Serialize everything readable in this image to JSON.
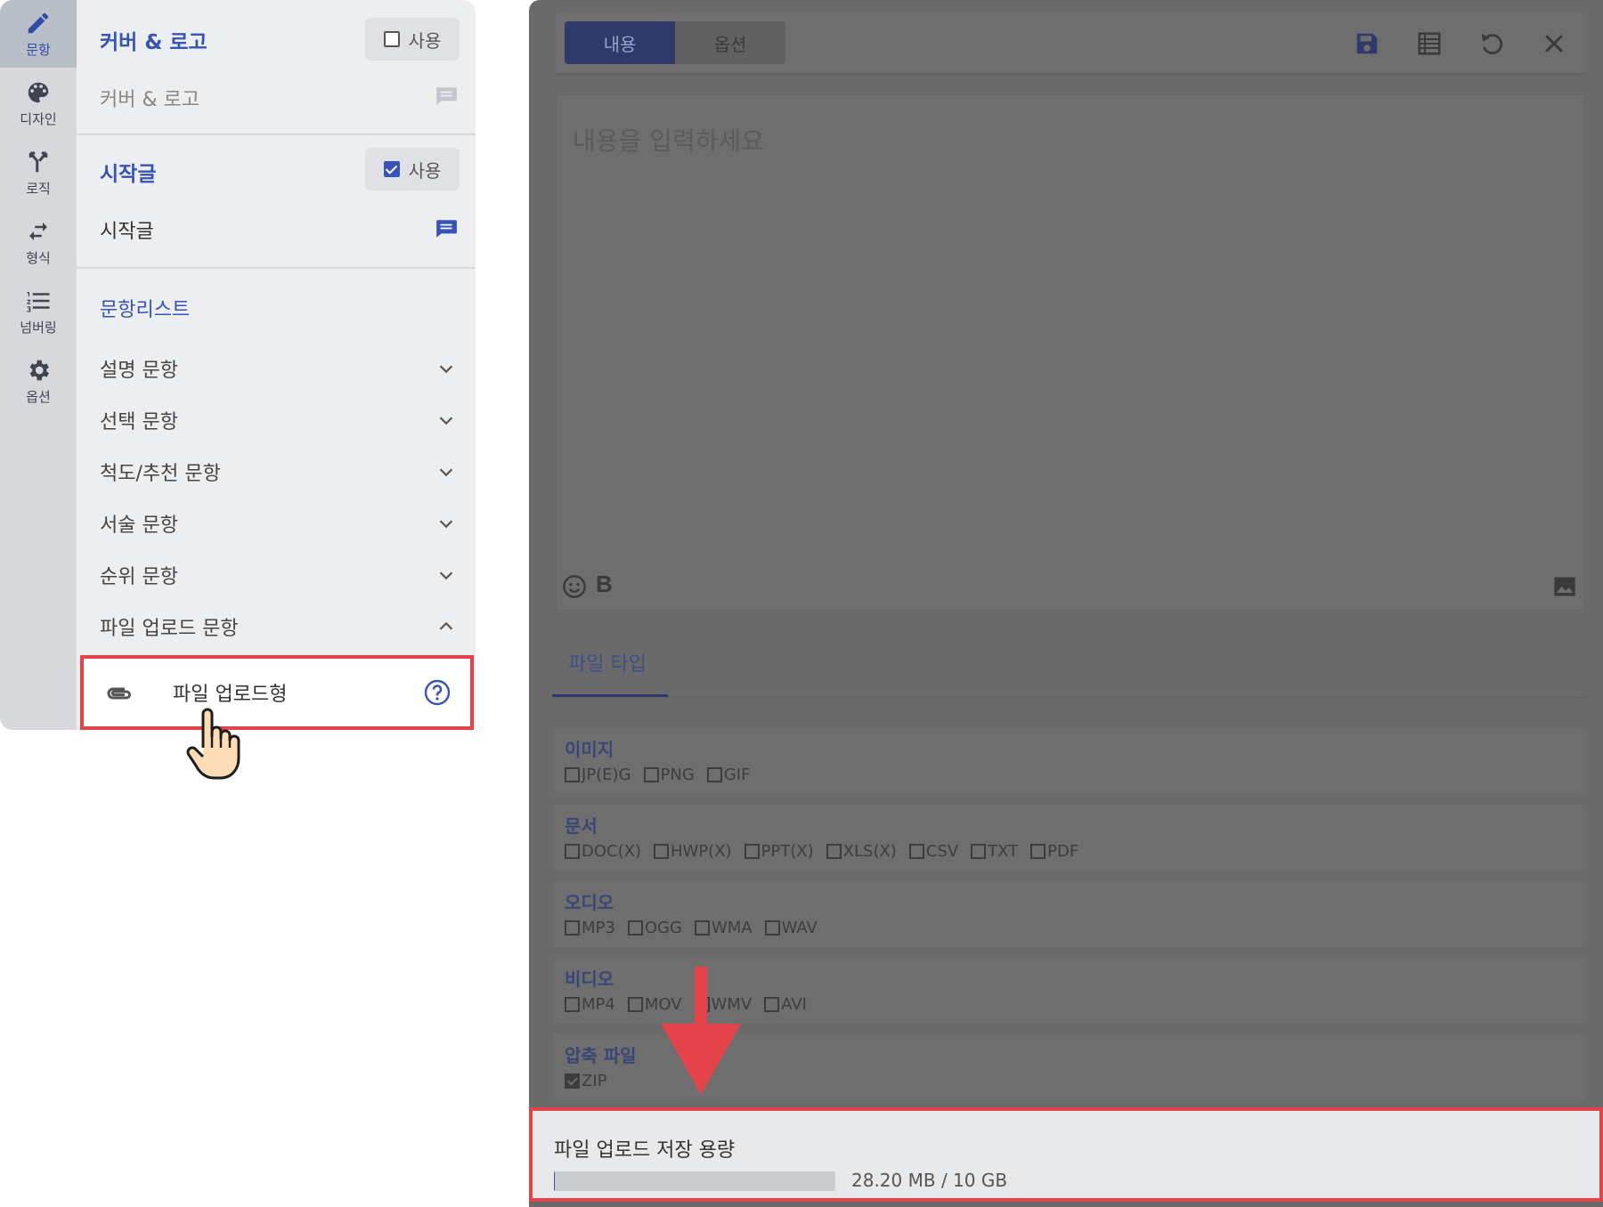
{
  "rail": {
    "items": [
      {
        "label": "문항",
        "icon": "pencil-icon"
      },
      {
        "label": "디자인",
        "icon": "palette-icon"
      },
      {
        "label": "로직",
        "icon": "branch-icon"
      },
      {
        "label": "형식",
        "icon": "swap-icon"
      },
      {
        "label": "넘버링",
        "icon": "numbered-list-icon"
      },
      {
        "label": "옵션",
        "icon": "gear-icon"
      }
    ]
  },
  "sections": {
    "cover": {
      "title": "커버 & 로고",
      "toggle_label": "사용",
      "toggle_checked": false,
      "sub": "커버 & 로고"
    },
    "intro": {
      "title": "시작글",
      "toggle_label": "사용",
      "toggle_checked": true,
      "sub": "시작글"
    },
    "qlist_title": "문항리스트"
  },
  "accordion": [
    {
      "label": "설명 문항",
      "expanded": false
    },
    {
      "label": "선택 문항",
      "expanded": false
    },
    {
      "label": "척도/추천 문항",
      "expanded": false
    },
    {
      "label": "서술 문항",
      "expanded": false
    },
    {
      "label": "순위 문항",
      "expanded": false
    },
    {
      "label": "파일 업로드 문항",
      "expanded": true
    }
  ],
  "sub_item": {
    "label": "파일 업로드형",
    "icon": "paperclip-icon"
  },
  "editor": {
    "tabs": [
      "내용",
      "옵션"
    ],
    "active_tab": "내용",
    "placeholder": "내용을 입력하세요",
    "bold_label": "B",
    "toolbar_icons": [
      "save-icon",
      "table-icon",
      "undo-icon",
      "close-icon"
    ]
  },
  "file_type_tab": "파일 타입",
  "file_groups": [
    {
      "title": "이미지",
      "options": [
        {
          "label": "JP(E)G",
          "checked": false
        },
        {
          "label": "PNG",
          "checked": false
        },
        {
          "label": "GIF",
          "checked": false
        }
      ]
    },
    {
      "title": "문서",
      "options": [
        {
          "label": "DOC(X)",
          "checked": false
        },
        {
          "label": "HWP(X)",
          "checked": false
        },
        {
          "label": "PPT(X)",
          "checked": false
        },
        {
          "label": "XLS(X)",
          "checked": false
        },
        {
          "label": "CSV",
          "checked": false
        },
        {
          "label": "TXT",
          "checked": false
        },
        {
          "label": "PDF",
          "checked": false
        }
      ]
    },
    {
      "title": "오디오",
      "options": [
        {
          "label": "MP3",
          "checked": false
        },
        {
          "label": "OGG",
          "checked": false
        },
        {
          "label": "WMA",
          "checked": false
        },
        {
          "label": "WAV",
          "checked": false
        }
      ]
    },
    {
      "title": "비디오",
      "options": [
        {
          "label": "MP4",
          "checked": false
        },
        {
          "label": "MOV",
          "checked": false
        },
        {
          "label": "WMV",
          "checked": false
        },
        {
          "label": "AVI",
          "checked": false
        }
      ]
    },
    {
      "title": "압축 파일",
      "options": [
        {
          "label": "ZIP",
          "checked": true
        }
      ]
    }
  ],
  "storage": {
    "title": "파일 업로드 저장 용량",
    "usage_text": "28.20 MB / 10 GB",
    "used_fraction": 0.0028
  },
  "colors": {
    "accent": "#3653b8",
    "highlight": "#e5434a"
  }
}
